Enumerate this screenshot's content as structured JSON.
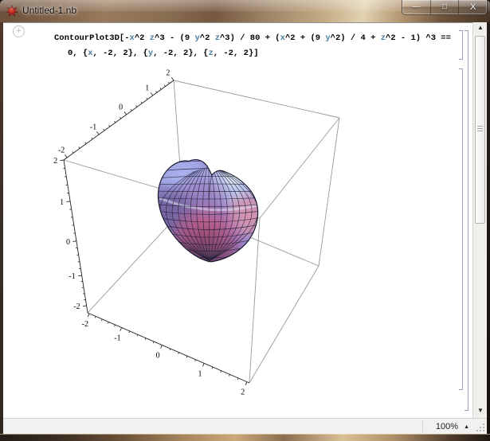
{
  "window": {
    "title": "Untitled-1.nb",
    "controls": {
      "minimize_glyph": "—",
      "maximize_glyph": "□",
      "close_glyph": "X"
    }
  },
  "notebook": {
    "insert_indicator_glyph": "+",
    "syntax_colors": {
      "plain": "#000000",
      "symbol": "#4e7f9e"
    },
    "input_cell": {
      "lines": [
        {
          "indent": 0,
          "segments": [
            {
              "text": "ContourPlot3D[-",
              "color": "plain"
            },
            {
              "text": "x",
              "color": "symbol"
            },
            {
              "text": "^2 ",
              "color": "plain"
            },
            {
              "text": "z",
              "color": "symbol"
            },
            {
              "text": "^3 - (9 ",
              "color": "plain"
            },
            {
              "text": "y",
              "color": "symbol"
            },
            {
              "text": "^2 ",
              "color": "plain"
            },
            {
              "text": "z",
              "color": "symbol"
            },
            {
              "text": "^3) / 80 + (",
              "color": "plain"
            },
            {
              "text": "x",
              "color": "symbol"
            },
            {
              "text": "^2 + (9 ",
              "color": "plain"
            },
            {
              "text": "y",
              "color": "symbol"
            },
            {
              "text": "^2) / 4 + ",
              "color": "plain"
            },
            {
              "text": "z",
              "color": "symbol"
            },
            {
              "text": "^2 - 1) ^3 ==",
              "color": "plain"
            }
          ]
        },
        {
          "indent": 17,
          "segments": [
            {
              "text": "0, {",
              "color": "plain"
            },
            {
              "text": "x",
              "color": "symbol"
            },
            {
              "text": ", -2, 2}, {",
              "color": "plain"
            },
            {
              "text": "y",
              "color": "symbol"
            },
            {
              "text": ", -2, 2}, {",
              "color": "plain"
            },
            {
              "text": "z",
              "color": "symbol"
            },
            {
              "text": ", -2, 2}]",
              "color": "plain"
            }
          ]
        }
      ]
    }
  },
  "chart_data": {
    "type": "contour3d-surface",
    "title": "",
    "description": "Heart-shaped implicit surface rendered by Mathematica ContourPlot3D with quadrilateral surface mesh inside a 3D wireframe bounding box",
    "equation": "-x^2 z^3 - (9 y^2 z^3)/80 + (x^2 + (9 y^2)/4 + z^2 - 1)^3 == 0",
    "ranges": {
      "x": [
        -2,
        2
      ],
      "y": [
        -2,
        2
      ],
      "z": [
        -2,
        2
      ]
    },
    "axes": {
      "x": {
        "ticks": [
          "-2",
          "-1",
          "0",
          "1",
          "2"
        ]
      },
      "y": {
        "ticks": [
          "-2",
          "-1",
          "0",
          "1",
          "2"
        ]
      },
      "z": {
        "ticks": [
          "2",
          "1",
          "0",
          "-1",
          "-2"
        ]
      }
    },
    "grid": false,
    "legend": false,
    "surface_colors": {
      "top_left_lobe": "#a9b2ec",
      "top_right_lobe": "#c6d3f2",
      "left_shadow": "#74639f",
      "bottom_center": "#c4547e",
      "right_highlight": "#d795ae",
      "bottom_rim": "#5c3f63",
      "mesh_line": "#1c1c30",
      "box_edge": "#989898",
      "axis_line": "#222222"
    }
  },
  "scrollbar": {
    "up_glyph": "▲",
    "down_glyph": "▼"
  },
  "status_bar": {
    "zoom_level": "100%",
    "zoom_caret_glyph": "▲"
  }
}
